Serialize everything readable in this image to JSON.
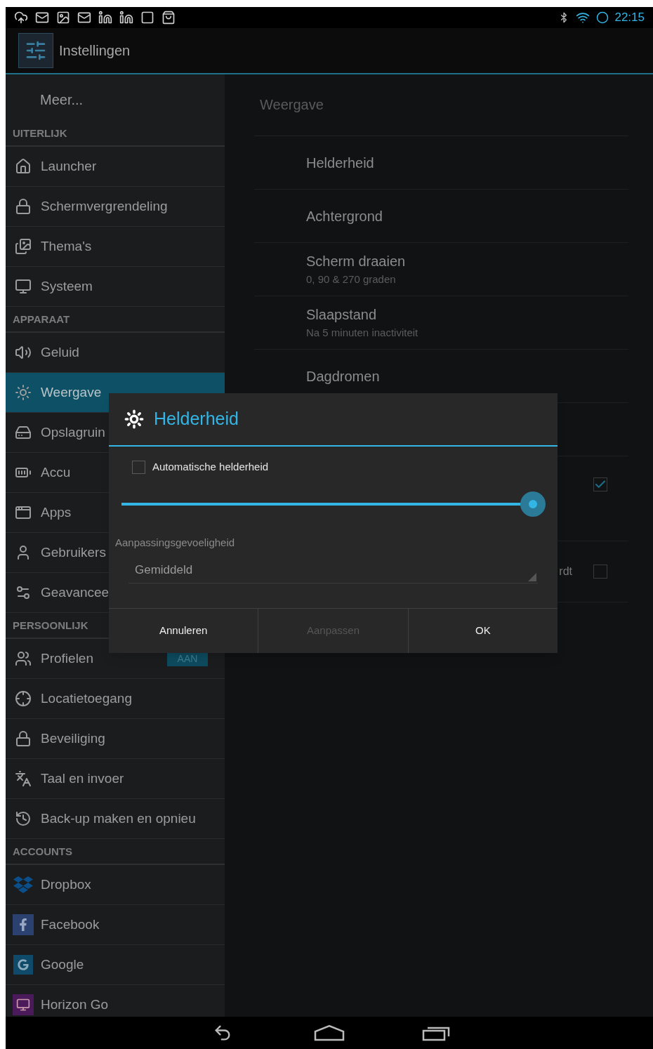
{
  "status_bar": {
    "time": "22:15"
  },
  "action_bar": {
    "title": "Instellingen"
  },
  "sidebar": {
    "top_item": {
      "label": "Meer...",
      "selected": false
    },
    "sections": [
      {
        "header": "UITERLIJK",
        "items": [
          {
            "label": "Launcher",
            "selected": false
          },
          {
            "label": "Schermvergrendeling",
            "selected": false
          },
          {
            "label": "Thema's",
            "selected": false
          },
          {
            "label": "Systeem",
            "selected": false
          }
        ]
      },
      {
        "header": "APPARAAT",
        "items": [
          {
            "label": "Geluid",
            "selected": false
          },
          {
            "label": "Weergave",
            "selected": true
          },
          {
            "label": "Opslagruin",
            "selected": false
          },
          {
            "label": "Accu",
            "selected": false
          },
          {
            "label": "Apps",
            "selected": false
          },
          {
            "label": "Gebruikers",
            "selected": false
          },
          {
            "label": "Geavancee",
            "selected": false
          }
        ]
      },
      {
        "header": "PERSOONLIJK",
        "items": [
          {
            "label": "Profielen",
            "selected": false,
            "toggle": {
              "label": "AAN",
              "on": true
            }
          },
          {
            "label": "Locatietoegang",
            "selected": false
          },
          {
            "label": "Beveiliging",
            "selected": false
          },
          {
            "label": "Taal en invoer",
            "selected": false
          },
          {
            "label": "Back-up maken en opnieu",
            "selected": false
          }
        ]
      },
      {
        "header": "ACCOUNTS",
        "items": [
          {
            "label": "Dropbox",
            "selected": false
          },
          {
            "label": "Facebook",
            "selected": false
          },
          {
            "label": "Google",
            "selected": false
          },
          {
            "label": "Horizon Go",
            "selected": false
          }
        ]
      }
    ]
  },
  "detail": {
    "header": "Weergave",
    "rows": [
      {
        "kind": "text",
        "title": "Helderheid"
      },
      {
        "kind": "text",
        "title": "Achtergrond"
      },
      {
        "kind": "text",
        "title": "Scherm draaien",
        "subtitle": "0, 90 & 270 graden"
      },
      {
        "kind": "text",
        "title": "Slaapstand",
        "subtitle": "Na 5 minuten inactiviteit"
      },
      {
        "kind": "text",
        "title": "Dagdromen"
      },
      {
        "kind": "hidden"
      },
      {
        "kind": "checkbox",
        "checked": true
      },
      {
        "kind": "checkbox",
        "title": "rdt",
        "checked": false
      }
    ]
  },
  "dialog": {
    "title": "Helderheid",
    "auto_checkbox": {
      "label": "Automatische helderheid",
      "checked": false
    },
    "slider": {
      "level": 1.0
    },
    "sensitivity": {
      "label": "Aanpassingsgevoeligheid",
      "value": "Gemiddeld"
    },
    "buttons": [
      {
        "label": "Annuleren",
        "disabled": false
      },
      {
        "label": "Aanpassen",
        "disabled": true
      },
      {
        "label": "OK",
        "disabled": false
      }
    ]
  }
}
